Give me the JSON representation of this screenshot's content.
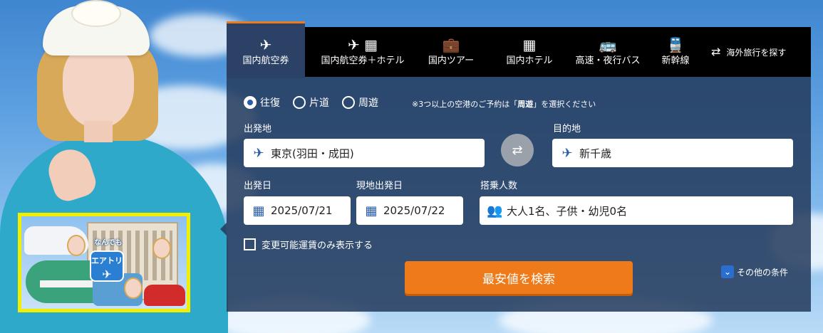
{
  "tabs": [
    {
      "label": "国内航空券",
      "icon": "plane-icon",
      "glyph": "✈",
      "active": true
    },
    {
      "label": "国内航空券＋ホテル",
      "icon": "plane-hotel-icon",
      "glyph": "✈ ▦",
      "active": false
    },
    {
      "label": "国内ツアー",
      "icon": "suitcase-icon",
      "glyph": "💼",
      "active": false
    },
    {
      "label": "国内ホテル",
      "icon": "hotel-icon",
      "glyph": "▦",
      "active": false
    },
    {
      "label": "高速・夜行バス",
      "icon": "bus-icon",
      "glyph": "🚌",
      "active": false
    },
    {
      "label": "新幹線",
      "icon": "train-icon",
      "glyph": "🚆",
      "active": false
    },
    {
      "label": "海外旅行を探す",
      "icon": "swap-arrows-icon",
      "glyph": "⇄",
      "active": false
    }
  ],
  "trip_type": {
    "options": [
      "往復",
      "片道",
      "周遊"
    ],
    "selected": "往復",
    "note_prefix": "※3つ以上の空港のご予約は「",
    "note_bold": "周遊",
    "note_suffix": "」を選択ください"
  },
  "origin": {
    "label": "出発地",
    "value": "東京(羽田・成田)"
  },
  "destination": {
    "label": "目的地",
    "value": "新千歳"
  },
  "depart_date": {
    "label": "出発日",
    "value": "2025/07/21"
  },
  "return_date": {
    "label": "現地出発日",
    "value": "2025/07/22"
  },
  "passengers": {
    "label": "搭乗人数",
    "value": "大人1名、子供・幼児0名"
  },
  "changeable_only": {
    "label": "変更可能運賃のみ表示する",
    "checked": false
  },
  "search_button": "最安値を検索",
  "other_conditions": {
    "label": "その他の条件",
    "checked": true
  },
  "promo": {
    "logo_text": "エアトリ",
    "speech": "なんでも"
  },
  "colors": {
    "accent": "#ef7a1a",
    "panel": "#243a5c",
    "tab_active": "#2b4166",
    "icon_blue": "#2a5da8",
    "promo_border": "#f2ee00"
  }
}
